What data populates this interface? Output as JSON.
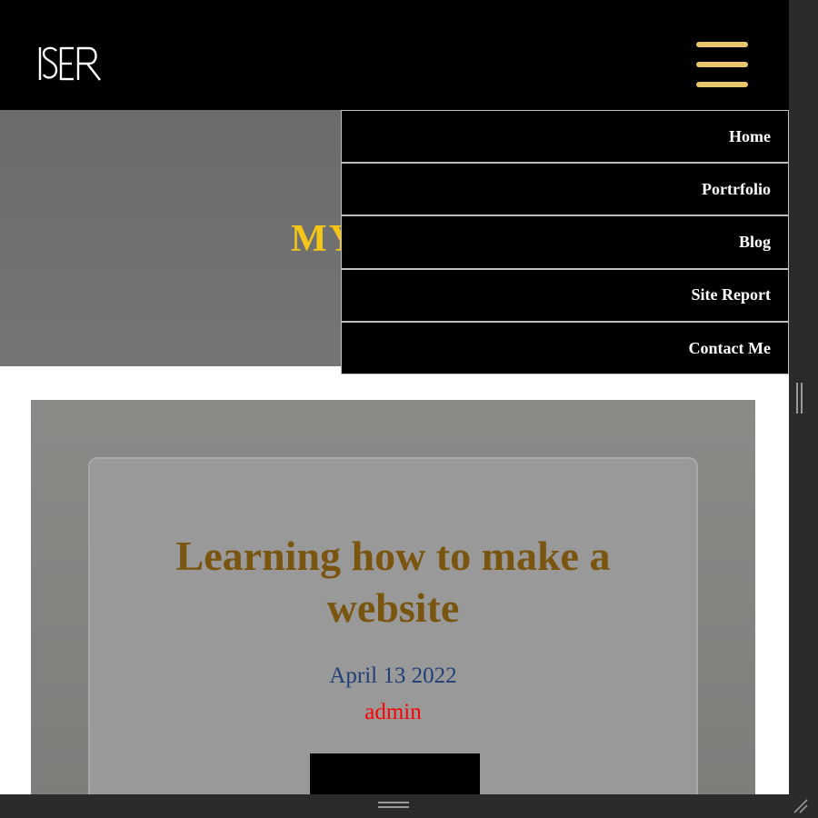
{
  "header": {
    "logo_text": "ISER",
    "menu_icon": "hamburger-menu-icon",
    "menu_icon_color": "#e8c66a"
  },
  "hero": {
    "title": "MY",
    "title_color": "#f5c518"
  },
  "nav_menu": {
    "items": [
      {
        "label": "Home"
      },
      {
        "label": "Portrfolio"
      },
      {
        "label": "Blog"
      },
      {
        "label": "Site Report"
      },
      {
        "label": "Contact Me"
      }
    ]
  },
  "post": {
    "title": "Learning how to make a website",
    "title_color": "#7a5510",
    "date": "April 13 2022",
    "date_color": "#1f3f78",
    "author": "admin",
    "author_color": "#ff0000"
  },
  "window": {
    "vertical_resize_icon": "vertical-grip-icon",
    "horizontal_resize_icon": "horizontal-grip-icon",
    "corner_resize_icon": "corner-resize-icon"
  }
}
